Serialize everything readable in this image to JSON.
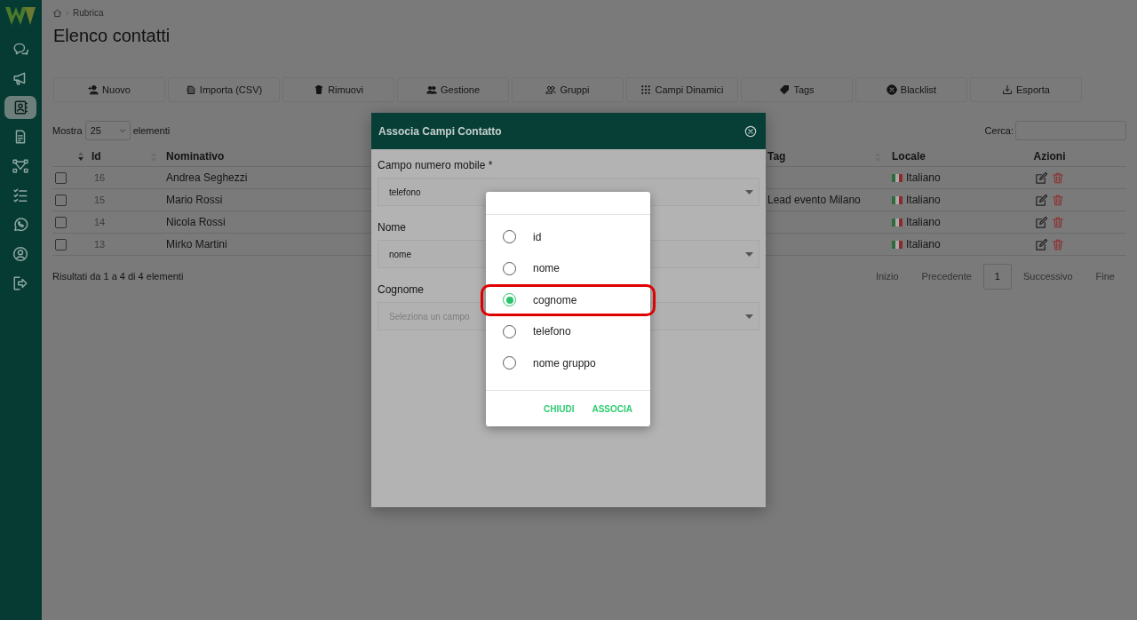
{
  "sidebar": {
    "items": [
      {
        "selected": false
      },
      {
        "selected": false
      },
      {
        "selected": true
      },
      {
        "selected": false
      },
      {
        "selected": false
      },
      {
        "selected": false
      },
      {
        "selected": false
      },
      {
        "selected": false
      },
      {
        "selected": false
      }
    ]
  },
  "breadcrumb": "Rubrica",
  "title": "Elenco contatti",
  "toolbar": [
    "Nuovo",
    "Importa (CSV)",
    "Rimuovi",
    "Gestione",
    "Gruppi",
    "Campi Dinamici",
    "Tags",
    "Blacklist",
    "Esporta"
  ],
  "length_menu": {
    "before": "Mostra",
    "value": "25",
    "after": "elementi"
  },
  "search": {
    "label": "Cerca:"
  },
  "table": {
    "columns": [
      "Id",
      "Nominativo",
      "Tag",
      "Locale",
      "Azioni"
    ],
    "rows": [
      {
        "checked": false,
        "id": "16",
        "name": "Andrea Seghezzi",
        "tag": "",
        "locale": "Italiano"
      },
      {
        "checked": false,
        "id": "15",
        "name": "Mario Rossi",
        "tag": "Lead evento Milano",
        "locale": "Italiano"
      },
      {
        "checked": false,
        "id": "14",
        "name": "Nicola Rossi",
        "tag": "",
        "locale": "Italiano"
      },
      {
        "checked": false,
        "id": "13",
        "name": "Mirko Martini",
        "tag": "",
        "locale": "Italiano"
      }
    ]
  },
  "info": "Risultati da 1 a 4 di 4 elementi",
  "pagination": [
    {
      "label": "Inizio",
      "selected": false
    },
    {
      "label": "Precedente",
      "selected": false
    },
    {
      "label": "1",
      "selected": true
    },
    {
      "label": "Successivo",
      "selected": false
    },
    {
      "label": "Fine",
      "selected": false
    }
  ],
  "modal": {
    "title": "Associa Campi Contatto",
    "fields": [
      {
        "label": "Campo numero mobile *",
        "value": "telefono"
      },
      {
        "label": "Nome",
        "value": "nome"
      },
      {
        "label": "Cognome",
        "placeholder": "Seleziona un campo"
      }
    ]
  },
  "picker": {
    "options": [
      {
        "label": "id",
        "selected": false
      },
      {
        "label": "nome",
        "selected": false
      },
      {
        "label": "cognome",
        "selected": true
      },
      {
        "label": "telefono",
        "selected": false
      },
      {
        "label": "nome gruppo",
        "selected": false
      }
    ],
    "buttons": [
      "CHIUDI",
      "ASSOCIA"
    ]
  }
}
